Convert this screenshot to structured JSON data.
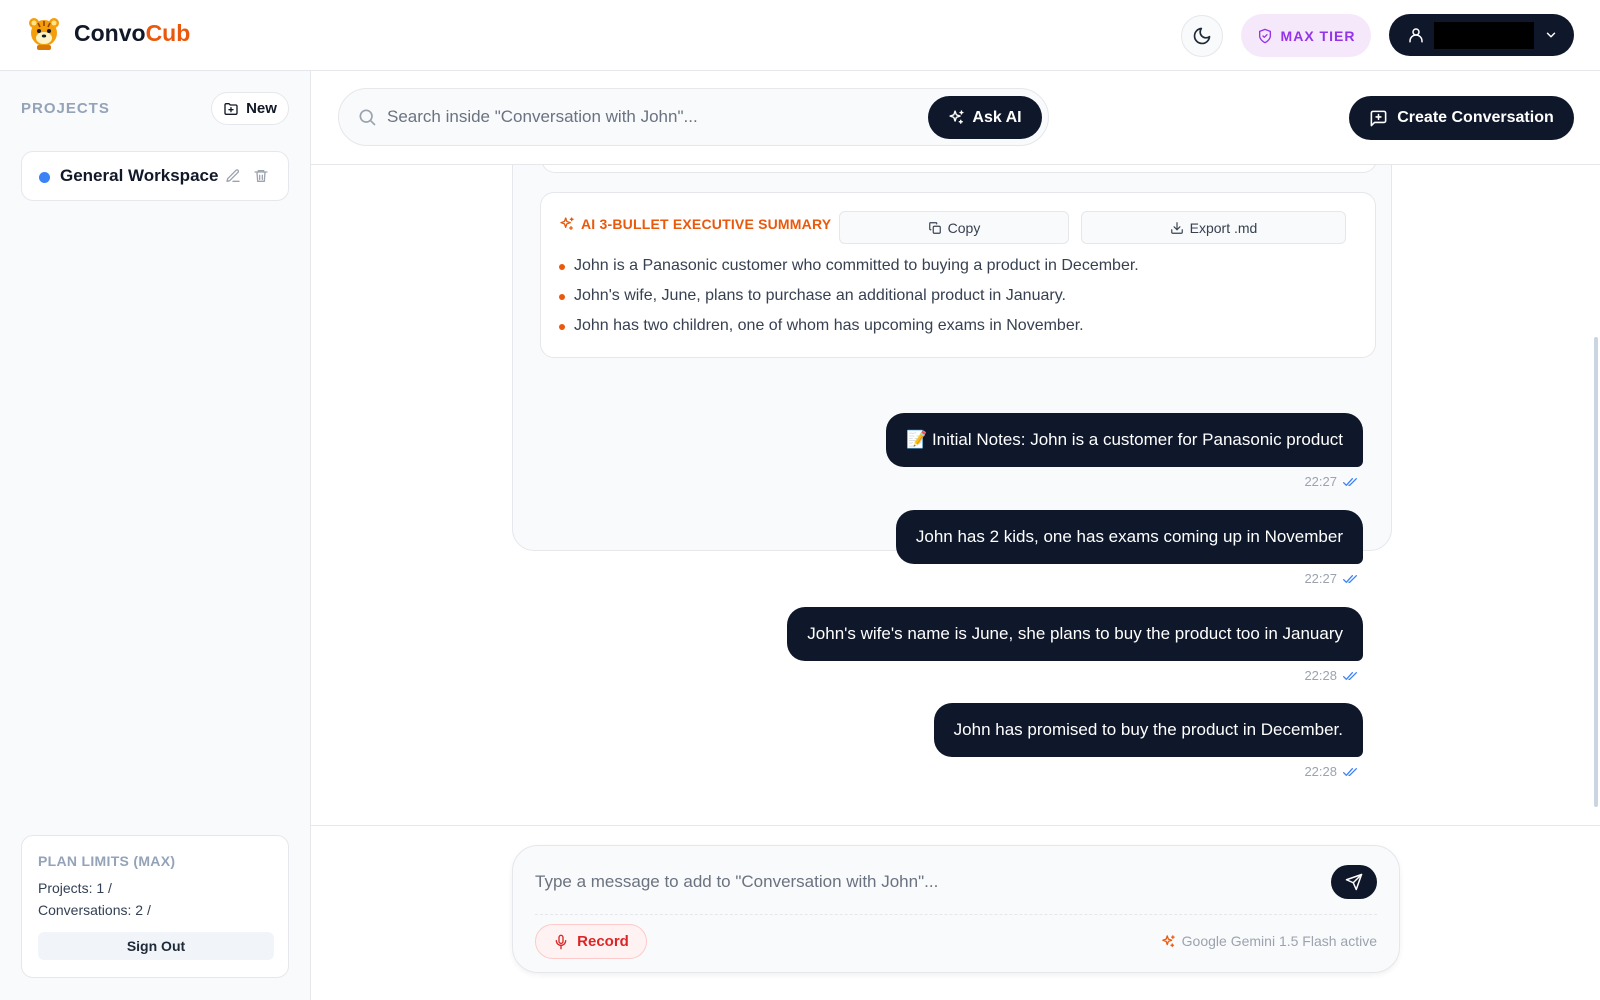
{
  "header": {
    "brand_part1": "Convo",
    "brand_part2": "Cub",
    "tier_label": "MAX TIER"
  },
  "sidebar": {
    "projects_label": "PROJECTS",
    "new_label": "New",
    "workspace_label": "General Workspace",
    "limits_title": "PLAN LIMITS (MAX)",
    "limits_projects": "Projects: 1 /",
    "limits_conversations": "Conversations: 2 /",
    "signout_label": "Sign Out"
  },
  "toolbar": {
    "search_placeholder": "Search inside \"Conversation with John\"...",
    "ask_ai_label": "Ask AI",
    "create_label": "Create Conversation"
  },
  "summary": {
    "title": "AI 3-BULLET EXECUTIVE SUMMARY",
    "copy_label": "Copy",
    "export_label": "Export .md",
    "bullets": [
      "John is a Panasonic customer who committed to buying a product in December.",
      "John's wife, June, plans to purchase an additional product in January.",
      "John has two children, one of whom has upcoming exams in November."
    ]
  },
  "messages": [
    {
      "text": "📝 Initial Notes: John is a customer for Panasonic product",
      "time": "22:27"
    },
    {
      "text": "John has 2 kids, one has exams coming up in November",
      "time": "22:27"
    },
    {
      "text": "John's wife's name is June, she plans to buy the product too in January",
      "time": "22:28"
    },
    {
      "text": "John has promised to buy the product in December.",
      "time": "22:28"
    }
  ],
  "composer": {
    "placeholder": "Type a message to add to \"Conversation with John\"...",
    "record_label": "Record",
    "model_status": "Google Gemini 1.5 Flash active"
  },
  "colors": {
    "accent": "#ea580c",
    "dark": "#0f172a",
    "tier": "#9333ea",
    "workspace_dot": "#3b82f6",
    "record": "#dc2626"
  },
  "icons": [
    "tiger-logo-icon",
    "moon-icon",
    "shield-icon",
    "user-icon",
    "chevron-down-icon",
    "folder-plus-icon",
    "edit-icon",
    "trash-icon",
    "search-icon",
    "sparkles-icon",
    "message-plus-icon",
    "copy-icon",
    "download-icon",
    "double-check-icon",
    "send-icon",
    "mic-icon"
  ]
}
